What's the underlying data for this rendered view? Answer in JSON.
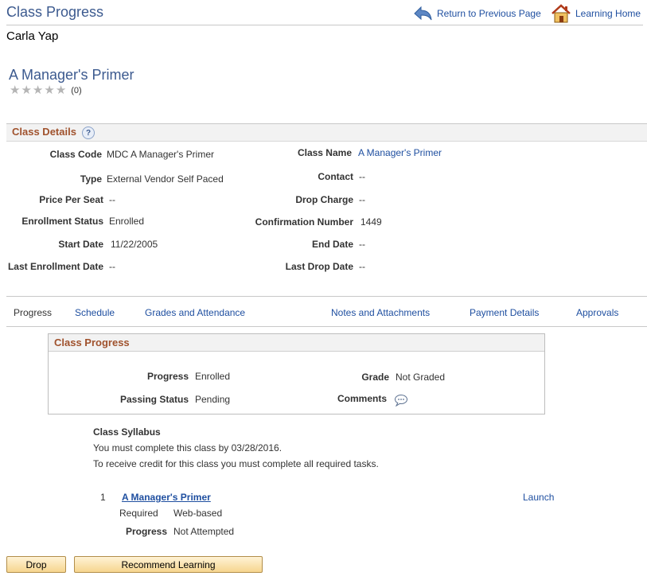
{
  "header": {
    "title": "Class Progress",
    "return_link": "Return to Previous Page",
    "home_link": "Learning Home"
  },
  "learner_name": "Carla Yap",
  "course": {
    "title": "A Manager's Primer",
    "rating_count": "(0)",
    "rating_value": 0,
    "rating_max": 5
  },
  "class_details": {
    "section_title": "Class Details",
    "help_glyph": "?",
    "left": [
      {
        "label": "Class Code",
        "value": "MDC A Manager's Primer"
      },
      {
        "label": "Type",
        "value": "External Vendor Self Paced"
      },
      {
        "label": "Price Per Seat",
        "value": "--"
      },
      {
        "label": "Enrollment Status",
        "value": "Enrolled"
      },
      {
        "label": "Start Date",
        "value": "11/22/2005"
      },
      {
        "label": "Last Enrollment Date",
        "value": "--"
      }
    ],
    "right": [
      {
        "label": "Class Name",
        "value": "A Manager's Primer"
      },
      {
        "label": "Contact",
        "value": "--"
      },
      {
        "label": "Drop Charge",
        "value": "--"
      },
      {
        "label": "Confirmation Number",
        "value": "1449"
      },
      {
        "label": "End Date",
        "value": "--"
      },
      {
        "label": "Last Drop Date",
        "value": "--"
      }
    ]
  },
  "tabs": [
    {
      "label": "Progress",
      "active": true
    },
    {
      "label": "Schedule",
      "active": false
    },
    {
      "label": "Grades and Attendance",
      "active": false
    },
    {
      "label": "Notes and Attachments",
      "active": false
    },
    {
      "label": "Payment Details",
      "active": false
    },
    {
      "label": "Approvals",
      "active": false
    }
  ],
  "class_progress": {
    "title": "Class Progress",
    "progress_label": "Progress",
    "progress_value": "Enrolled",
    "passing_label": "Passing Status",
    "passing_value": "Pending",
    "grade_label": "Grade",
    "grade_value": "Not Graded",
    "comments_label": "Comments"
  },
  "syllabus": {
    "title": "Class Syllabus",
    "line1": "You must complete this class by 03/28/2016.",
    "line2": "To receive credit for this class you must complete all required tasks.",
    "items": [
      {
        "number": "1",
        "title": "A Manager's Primer",
        "required": "Required",
        "delivery": "Web-based",
        "progress_label": "Progress",
        "progress_value": "Not Attempted",
        "launch": "Launch"
      }
    ]
  },
  "buttons": {
    "drop": "Drop",
    "recommend": "Recommend Learning"
  },
  "colors": {
    "title_blue": "#3c5a8f",
    "link_blue": "#1f4fa0",
    "section_brown": "#a0522d",
    "button_gold": "#f6d58e"
  }
}
